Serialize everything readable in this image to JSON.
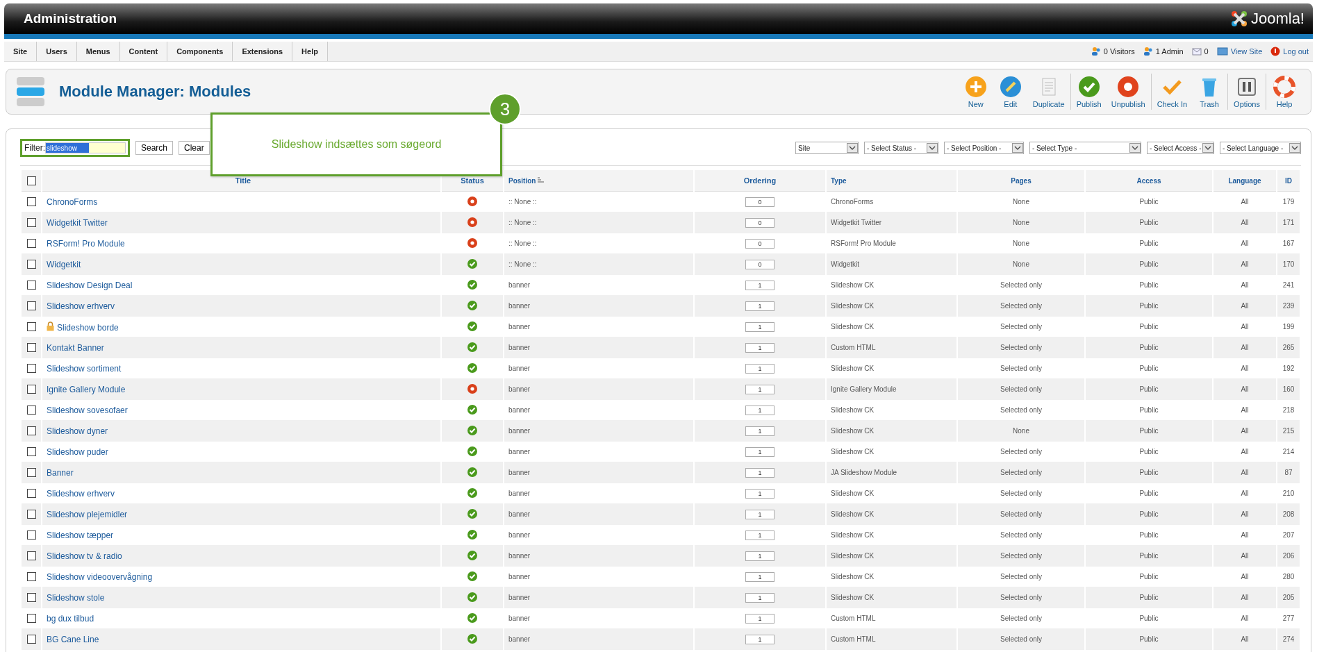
{
  "header": {
    "title": "Administration",
    "logo": "Joomla!"
  },
  "menu": [
    "Site",
    "Users",
    "Menus",
    "Content",
    "Components",
    "Extensions",
    "Help"
  ],
  "status_links": [
    {
      "kind": "visitors",
      "label": "0 Visitors"
    },
    {
      "kind": "admins",
      "label": "1 Admin"
    },
    {
      "kind": "messages",
      "label": "0"
    },
    {
      "kind": "view",
      "label": "View Site"
    },
    {
      "kind": "logout",
      "label": "Log out"
    }
  ],
  "page_title": "Module Manager: Modules",
  "toolbar": [
    {
      "kind": "new",
      "label": "New"
    },
    {
      "kind": "edit",
      "label": "Edit"
    },
    {
      "kind": "duplicate",
      "label": "Duplicate"
    },
    {
      "kind": "publish",
      "label": "Publish"
    },
    {
      "kind": "unpublish",
      "label": "Unpublish"
    },
    {
      "kind": "checkin",
      "label": "Check In"
    },
    {
      "kind": "trash",
      "label": "Trash"
    },
    {
      "kind": "options",
      "label": "Options"
    },
    {
      "kind": "help",
      "label": "Help"
    }
  ],
  "filter": {
    "label": "Filter:",
    "value": "slideshow",
    "buttons": [
      "Search",
      "Clear"
    ]
  },
  "selects": [
    "Site",
    "- Select Status -",
    "- Select Position -",
    "- Select Type -",
    "- Select Access -",
    "- Select Language -"
  ],
  "callout": {
    "badge": "3",
    "text": "Slideshow indsættes som søgeord"
  },
  "table": {
    "all_checked": false,
    "columns": [
      "Title",
      "Status",
      "Position",
      "Ordering",
      "Type",
      "Pages",
      "Access",
      "Language",
      "ID"
    ],
    "rows": [
      {
        "checked": false,
        "title": "ChronoForms",
        "locked": false,
        "published": false,
        "position": ":: None ::",
        "ordering": "0",
        "type": "ChronoForms",
        "pages": "None",
        "access": "Public",
        "language": "All",
        "id": "179"
      },
      {
        "checked": false,
        "title": "Widgetkit Twitter",
        "locked": false,
        "published": false,
        "position": ":: None ::",
        "ordering": "0",
        "type": "Widgetkit Twitter",
        "pages": "None",
        "access": "Public",
        "language": "All",
        "id": "171"
      },
      {
        "checked": false,
        "title": "RSForm! Pro Module",
        "locked": false,
        "published": false,
        "position": ":: None ::",
        "ordering": "0",
        "type": "RSForm! Pro Module",
        "pages": "None",
        "access": "Public",
        "language": "All",
        "id": "167"
      },
      {
        "checked": false,
        "title": "Widgetkit",
        "locked": false,
        "published": true,
        "position": ":: None ::",
        "ordering": "0",
        "type": "Widgetkit",
        "pages": "None",
        "access": "Public",
        "language": "All",
        "id": "170"
      },
      {
        "checked": false,
        "title": "Slideshow Design Deal",
        "locked": false,
        "published": true,
        "position": "banner",
        "ordering": "1",
        "type": "Slideshow CK",
        "pages": "Selected only",
        "access": "Public",
        "language": "All",
        "id": "241"
      },
      {
        "checked": false,
        "title": "Slideshow erhverv",
        "locked": false,
        "published": true,
        "position": "banner",
        "ordering": "1",
        "type": "Slideshow CK",
        "pages": "Selected only",
        "access": "Public",
        "language": "All",
        "id": "239"
      },
      {
        "checked": false,
        "title": "Slideshow borde",
        "locked": true,
        "published": true,
        "position": "banner",
        "ordering": "1",
        "type": "Slideshow CK",
        "pages": "Selected only",
        "access": "Public",
        "language": "All",
        "id": "199"
      },
      {
        "checked": false,
        "title": "Kontakt Banner",
        "locked": false,
        "published": true,
        "position": "banner",
        "ordering": "1",
        "type": "Custom HTML",
        "pages": "Selected only",
        "access": "Public",
        "language": "All",
        "id": "265"
      },
      {
        "checked": false,
        "title": "Slideshow sortiment",
        "locked": false,
        "published": true,
        "position": "banner",
        "ordering": "1",
        "type": "Slideshow CK",
        "pages": "Selected only",
        "access": "Public",
        "language": "All",
        "id": "192"
      },
      {
        "checked": false,
        "title": "Ignite Gallery Module",
        "locked": false,
        "published": false,
        "position": "banner",
        "ordering": "1",
        "type": "Ignite Gallery Module",
        "pages": "Selected only",
        "access": "Public",
        "language": "All",
        "id": "160"
      },
      {
        "checked": false,
        "title": "Slideshow sovesofaer",
        "locked": false,
        "published": true,
        "position": "banner",
        "ordering": "1",
        "type": "Slideshow CK",
        "pages": "Selected only",
        "access": "Public",
        "language": "All",
        "id": "218"
      },
      {
        "checked": false,
        "title": "Slideshow dyner",
        "locked": false,
        "published": true,
        "position": "banner",
        "ordering": "1",
        "type": "Slideshow CK",
        "pages": "None",
        "access": "Public",
        "language": "All",
        "id": "215"
      },
      {
        "checked": false,
        "title": "Slideshow puder",
        "locked": false,
        "published": true,
        "position": "banner",
        "ordering": "1",
        "type": "Slideshow CK",
        "pages": "Selected only",
        "access": "Public",
        "language": "All",
        "id": "214"
      },
      {
        "checked": false,
        "title": "Banner",
        "locked": false,
        "published": true,
        "position": "banner",
        "ordering": "1",
        "type": "JA Slideshow Module",
        "pages": "Selected only",
        "access": "Public",
        "language": "All",
        "id": "87"
      },
      {
        "checked": false,
        "title": "Slideshow erhverv",
        "locked": false,
        "published": true,
        "position": "banner",
        "ordering": "1",
        "type": "Slideshow CK",
        "pages": "Selected only",
        "access": "Public",
        "language": "All",
        "id": "210"
      },
      {
        "checked": false,
        "title": "Slideshow plejemidler",
        "locked": false,
        "published": true,
        "position": "banner",
        "ordering": "1",
        "type": "Slideshow CK",
        "pages": "Selected only",
        "access": "Public",
        "language": "All",
        "id": "208"
      },
      {
        "checked": false,
        "title": "Slideshow tæpper",
        "locked": false,
        "published": true,
        "position": "banner",
        "ordering": "1",
        "type": "Slideshow CK",
        "pages": "Selected only",
        "access": "Public",
        "language": "All",
        "id": "207"
      },
      {
        "checked": false,
        "title": "Slideshow tv & radio",
        "locked": false,
        "published": true,
        "position": "banner",
        "ordering": "1",
        "type": "Slideshow CK",
        "pages": "Selected only",
        "access": "Public",
        "language": "All",
        "id": "206"
      },
      {
        "checked": false,
        "title": "Slideshow videoovervågning",
        "locked": false,
        "published": true,
        "position": "banner",
        "ordering": "1",
        "type": "Slideshow CK",
        "pages": "Selected only",
        "access": "Public",
        "language": "All",
        "id": "280"
      },
      {
        "checked": false,
        "title": "Slideshow stole",
        "locked": false,
        "published": true,
        "position": "banner",
        "ordering": "1",
        "type": "Slideshow CK",
        "pages": "Selected only",
        "access": "Public",
        "language": "All",
        "id": "205"
      },
      {
        "checked": false,
        "title": "bg dux tilbud",
        "locked": false,
        "published": true,
        "position": "banner",
        "ordering": "1",
        "type": "Custom HTML",
        "pages": "Selected only",
        "access": "Public",
        "language": "All",
        "id": "277"
      },
      {
        "checked": false,
        "title": "BG Cane Line",
        "locked": false,
        "published": true,
        "position": "banner",
        "ordering": "1",
        "type": "Custom HTML",
        "pages": "Selected only",
        "access": "Public",
        "language": "All",
        "id": "274"
      }
    ]
  }
}
